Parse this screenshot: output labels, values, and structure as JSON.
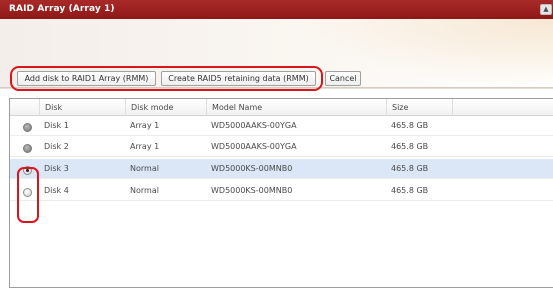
{
  "window": {
    "title": "RAID Array (Array 1)",
    "collapse_glyph": "▲"
  },
  "toolbar": {
    "add_label": "Add disk to RAID1 Array (RMM)",
    "create_label": "Create RAID5 retaining data (RMM)",
    "cancel_label": "Cancel"
  },
  "grid": {
    "columns": [
      "Disk",
      "Disk mode",
      "Model Name",
      "Size"
    ],
    "rows": [
      {
        "disk": "Disk 1",
        "mode": "Array 1",
        "model": "WD5000AAKS-00YGA",
        "size": "465.8 GB",
        "radio": "disabled",
        "selected": false
      },
      {
        "disk": "Disk 2",
        "mode": "Array 1",
        "model": "WD5000AAKS-00YGA",
        "size": "465.8 GB",
        "radio": "disabled",
        "selected": false
      },
      {
        "disk": "Disk 3",
        "mode": "Normal",
        "model": "WD5000KS-00MNB0",
        "size": "465.8 GB",
        "radio": "checked",
        "selected": true
      },
      {
        "disk": "Disk 4",
        "mode": "Normal",
        "model": "WD5000KS-00MNB0",
        "size": "465.8 GB",
        "radio": "unchecked",
        "selected": false
      }
    ]
  },
  "colors": {
    "titlebar": "#9b1f1e",
    "highlight": "#d9161c",
    "selected_row": "#dbe6f7"
  }
}
